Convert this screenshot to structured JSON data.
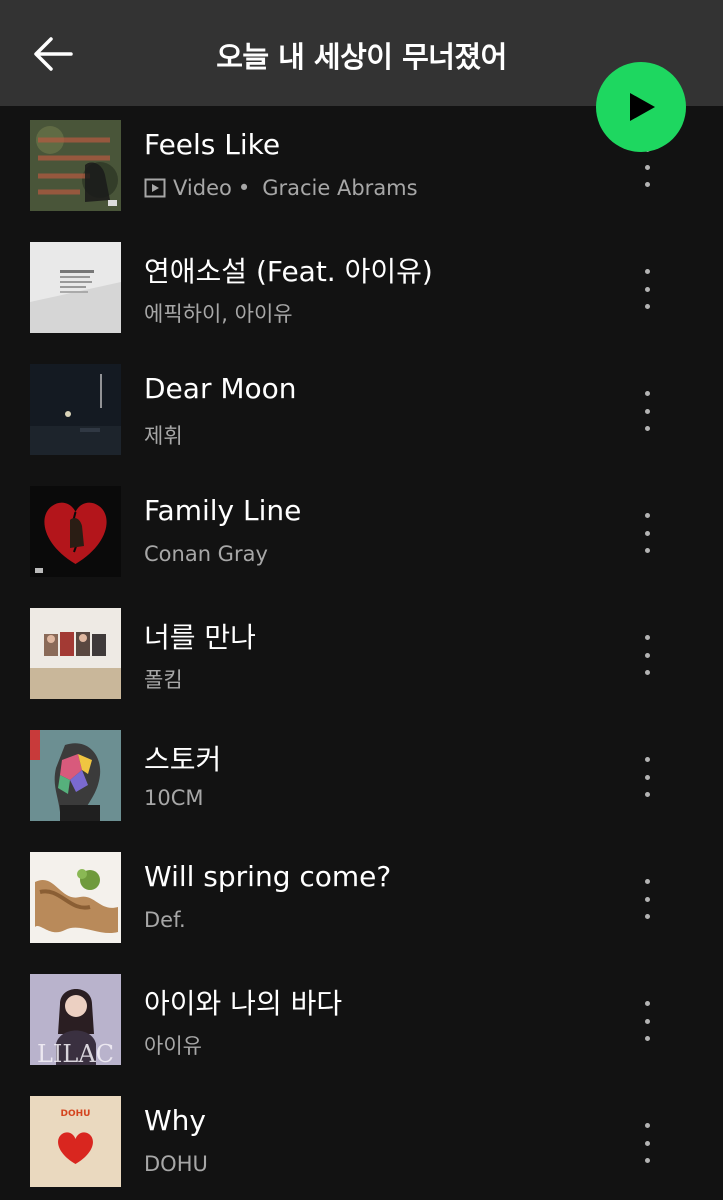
{
  "header": {
    "title": "오늘 내 세상이 무너졌어"
  },
  "colors": {
    "accent": "#1ed760",
    "background": "#121212",
    "header": "#333333"
  },
  "tracks": [
    {
      "title": "Feels Like",
      "type": "Video",
      "artist": "Gracie Abrams",
      "art_icon": "album-art-feels-like"
    },
    {
      "title": "연애소설 (Feat. 아이유)",
      "artist": "에픽하이, 아이유",
      "art_icon": "album-art-epik-high"
    },
    {
      "title": "Dear Moon",
      "artist": "제휘",
      "art_icon": "album-art-dear-moon"
    },
    {
      "title": "Family Line",
      "artist": "Conan Gray",
      "art_icon": "album-art-family-line"
    },
    {
      "title": "너를 만나",
      "artist": "폴킴",
      "art_icon": "album-art-paul-kim"
    },
    {
      "title": "스토커",
      "artist": "10CM",
      "art_icon": "album-art-10cm"
    },
    {
      "title": "Will spring come?",
      "artist": "Def.",
      "art_icon": "album-art-def"
    },
    {
      "title": "아이와 나의 바다",
      "artist": "아이유",
      "art_icon": "album-art-lilac"
    },
    {
      "title": "Why",
      "artist": "DOHU",
      "art_icon": "album-art-dohu"
    }
  ],
  "album_art_text": {
    "lilac": "LILAC",
    "dohu": "DOHU"
  }
}
